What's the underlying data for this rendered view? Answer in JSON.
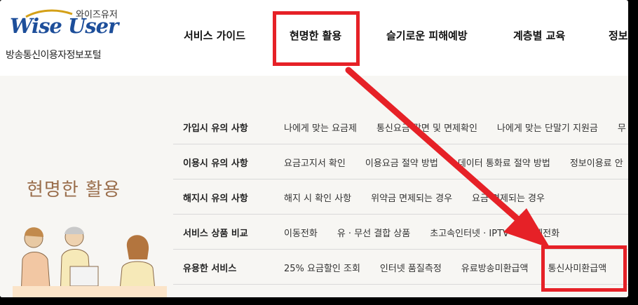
{
  "logo": {
    "korean": "와이즈유저",
    "english": "Wise User",
    "subtitle": "방송통신이용자정보포털"
  },
  "nav": {
    "items": [
      "서비스 가이드",
      "현명한 활용",
      "슬기로운 피해예방",
      "계층별 교육",
      "정보공"
    ]
  },
  "side_title": "현명한 활용",
  "menu": {
    "rows": [
      {
        "title": "가입시 유의 사항",
        "links": [
          "나에게 맞는 요금제",
          "통신요금 감면 및 면제확인",
          "나에게 맞는 단말기 지원금",
          "무"
        ]
      },
      {
        "title": "이용시 유의 사항",
        "links": [
          "요금고지서 확인",
          "이용요금 절약 방법",
          "데이터 통화료 절약 방법",
          "정보이용료 안"
        ]
      },
      {
        "title": "해지시 유의 사항",
        "links": [
          "해지 시 확인 사항",
          "위약금 면제되는 경우",
          "요금 면제되는 경우"
        ]
      },
      {
        "title": "서비스 상품 비교",
        "links": [
          "이동전화",
          "유 · 무선 결합 상품",
          "초고속인터넷 · IPTV · 인터넷전화"
        ]
      },
      {
        "title": "유용한 서비스",
        "links": [
          "25% 요금할인 조회",
          "인터넷 품질측정",
          "유료방송미환급액",
          "통신사미환급액"
        ]
      }
    ]
  },
  "annotation_color": "#e62127"
}
